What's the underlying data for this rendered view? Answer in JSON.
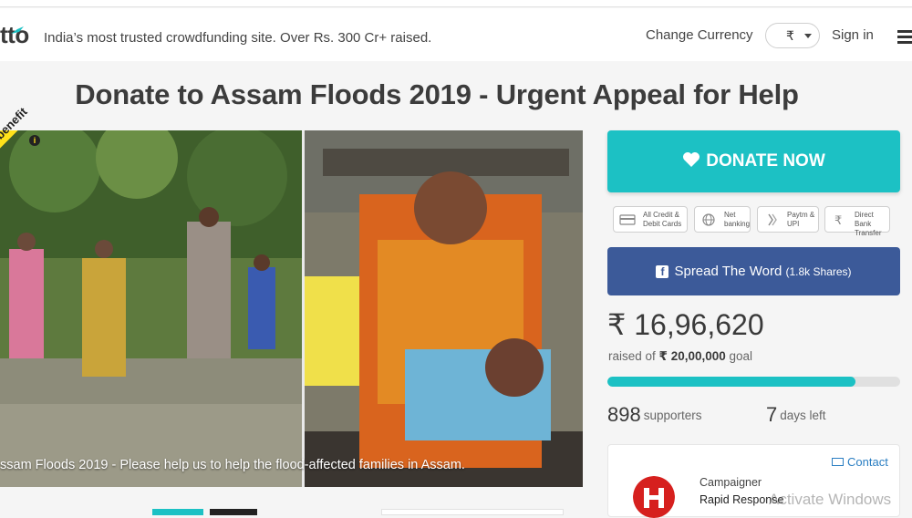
{
  "header": {
    "logo_text": "tto",
    "tagline": "India’s most trusted crowdfunding site. Over Rs. 300 Cr+ raised.",
    "change_currency_label": "Change Currency",
    "currency_symbol": "₹",
    "sign_in_label": "Sign in"
  },
  "campaign": {
    "title": "Donate to Assam Floods 2019 - Urgent Appeal for Help",
    "hero_caption": "ssam Floods 2019 - Please help us to help the flood-affected families in Assam.",
    "benefit_badge": "benefit"
  },
  "sidebar": {
    "donate_label": "DONATE NOW",
    "payment_options": [
      {
        "icon": "card-icon",
        "line1": "All Credit &",
        "line2": "Debit Cards"
      },
      {
        "icon": "globe-icon",
        "line1": "Net",
        "line2": "banking"
      },
      {
        "icon": "upi-icon",
        "line1": "Paytm &",
        "line2": "UPI"
      },
      {
        "icon": "rupee-icon",
        "line1": "Direct Bank",
        "line2": "Transfer"
      }
    ],
    "spread_label": "Spread The Word",
    "shares_label": "(1.8k Shares)",
    "raised_amount": "₹ 16,96,620",
    "raised_of_prefix": "raised of",
    "goal_amount": "₹ 20,00,000",
    "goal_suffix": "goal",
    "progress_fraction": 0.848,
    "supporters_count": "898",
    "supporters_label": "supporters",
    "days_count": "7",
    "days_label": "days left",
    "contact_label": "Contact",
    "campaigner_label": "Campaigner",
    "campaigner_name": "Rapid Response"
  },
  "system": {
    "watermark": "Activate Windows"
  },
  "colors": {
    "accent_teal": "#1cc1c4",
    "facebook_blue": "#3c5a99",
    "badge_yellow": "#ffe21a",
    "campaigner_red": "#d6201e"
  }
}
